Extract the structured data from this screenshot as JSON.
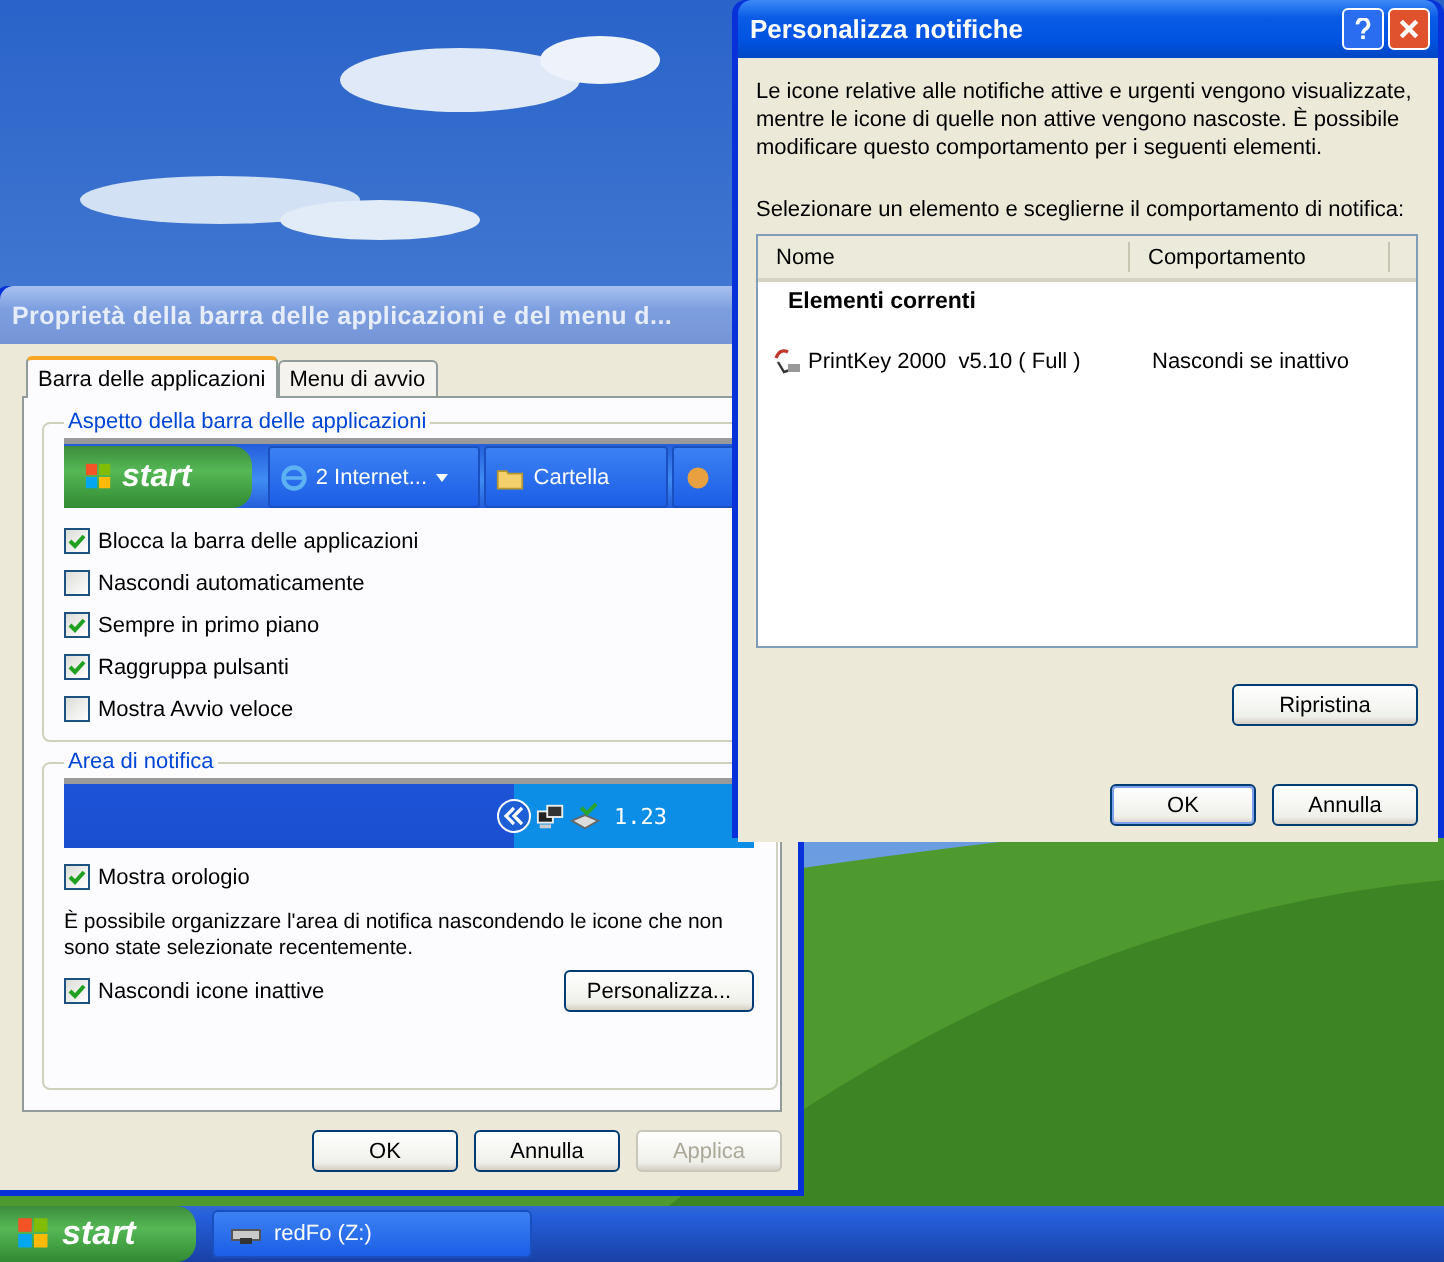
{
  "properties_window": {
    "title": "Proprietà della barra delle applicazioni e del menu d...",
    "tabs": [
      {
        "label": "Barra delle applicazioni",
        "selected": true
      },
      {
        "label": "Menu di avvio",
        "selected": false
      }
    ],
    "appearance_group": {
      "title": "Aspetto della barra delle applicazioni",
      "preview_start": "start",
      "preview_items": [
        {
          "label": "2 Internet...",
          "kind": "browser"
        },
        {
          "label": "Cartella",
          "kind": "folder"
        }
      ],
      "options": [
        {
          "label": "Blocca la barra delle applicazioni",
          "checked": true
        },
        {
          "label": "Nascondi automaticamente",
          "checked": false
        },
        {
          "label": "Sempre in primo piano",
          "checked": true
        },
        {
          "label": "Raggruppa pulsanti",
          "checked": true
        },
        {
          "label": "Mostra Avvio veloce",
          "checked": false
        }
      ]
    },
    "notification_group": {
      "title": "Area di notifica",
      "clock": "1.23",
      "show_clock": {
        "label": "Mostra orologio",
        "checked": true
      },
      "description": "È possibile organizzare l'area di notifica nascondendo le icone che non sono state selezionate recentemente.",
      "hide_inactive": {
        "label": "Nascondi icone inattive",
        "checked": true
      },
      "customize_button": "Personalizza..."
    },
    "buttons": [
      {
        "label": "OK",
        "disabled": false
      },
      {
        "label": "Annulla",
        "disabled": false
      },
      {
        "label": "Applica",
        "disabled": true
      }
    ]
  },
  "notifications_dialog": {
    "title": "Personalizza notifiche",
    "description": "Le icone relative alle notifiche attive e urgenti vengono visualizzate, mentre le icone di quelle non attive vengono nascoste. È possibile modificare questo comportamento per i seguenti elementi.",
    "instruction": "Selezionare un elemento e sceglierne il comportamento di notifica:",
    "columns": [
      "Nome",
      "Comportamento"
    ],
    "groups": [
      {
        "title": "Elementi correnti",
        "rows": [
          {
            "name": "PrintKey 2000  v5.10 ( Full )",
            "behavior": "Nascondi se inattivo"
          }
        ]
      }
    ],
    "reset_button": "Ripristina",
    "buttons": [
      {
        "label": "OK",
        "default": true
      },
      {
        "label": "Annulla",
        "default": false
      }
    ]
  },
  "taskbar": {
    "start": "start",
    "items": [
      "redFo (Z:)"
    ]
  }
}
